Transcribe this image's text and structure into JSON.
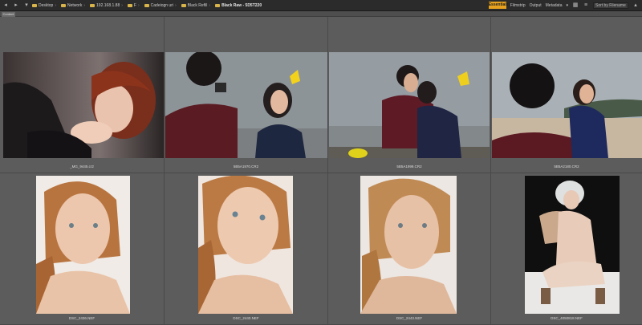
{
  "toolbar": {
    "breadcrumbs": [
      "Desktop",
      "Network",
      "192.168.1.88",
      "F",
      "Cadeiogn uri",
      "Black Refill",
      "Black Raw - 5D5T220"
    ],
    "workspace_tabs": [
      "Essentials",
      "Filmstrip",
      "Output",
      "Metadata"
    ],
    "search_placeholder": "Sort by Filename"
  },
  "content_tab": "Content",
  "files": [
    {
      "name": "_MG_9445.cr2"
    },
    {
      "name": "5B5A1970.CR2"
    },
    {
      "name": "5B5A1999.CR2"
    },
    {
      "name": "5B5A2180.CR2"
    },
    {
      "name": "DSC_2436.NEF"
    },
    {
      "name": "DSC_2440.NEF"
    },
    {
      "name": "DSC_2443.NEF"
    },
    {
      "name": "DSC_4050818.NEF"
    }
  ]
}
